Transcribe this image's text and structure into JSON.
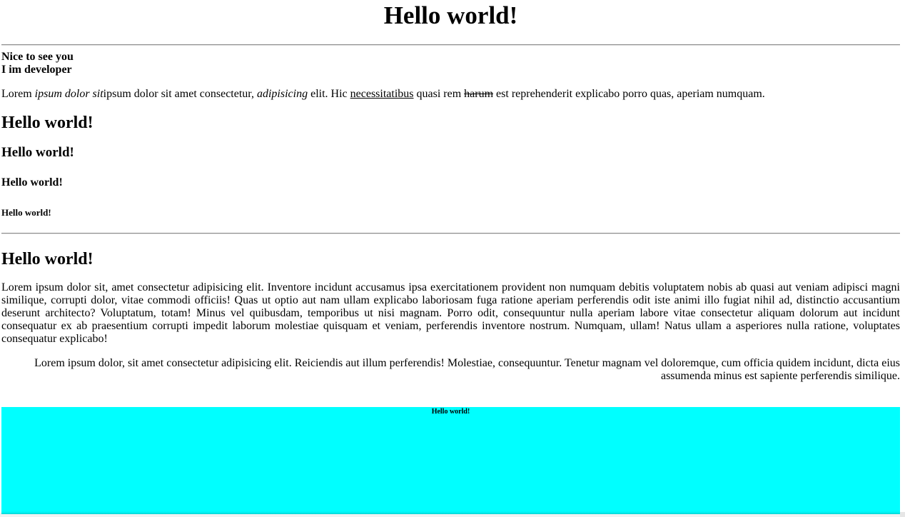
{
  "heading_main": "Hello world!",
  "intro": {
    "line1": "Nice to see you",
    "line2": "I im developer"
  },
  "paragraph1": {
    "part1": "Lorem ",
    "italic1": "ipsum dolor sit",
    "part2": "ipsum dolor sit amet consectetur, ",
    "italic2": "adipisicing",
    "part3": " elit. Hic ",
    "underlined": "necessitatibus",
    "part4": " quasi rem ",
    "struck": "harum",
    "part5": " est reprehenderit explicabo porro quas, aperiam numquam."
  },
  "headings": {
    "h2": "Hello world!",
    "h3": "Hello world!",
    "h4": "Hello world!",
    "h5": "Hello world!"
  },
  "section2": {
    "heading": "Hello world!",
    "justified_text": "Lorem ipsum dolor sit, amet consectetur adipisicing elit. Inventore incidunt accusamus ipsa exercitationem provident non numquam debitis voluptatem nobis ab quasi aut veniam adipisci magni similique, corrupti dolor, vitae commodi officiis! Quas ut optio aut nam ullam explicabo laboriosam fuga ratione aperiam perferendis odit iste animi illo fugiat nihil ad, distinctio accusantium deserunt architecto? Voluptatum, totam! Minus vel quibusdam, temporibus ut nisi magnam. Porro odit, consequuntur nulla aperiam labore vitae consectetur aliquam dolorum aut incidunt consequatur ex ab praesentium corrupti impedit laborum molestiae quisquam et veniam, perferendis inventore nostrum. Numquam, ullam! Natus ullam a asperiores nulla ratione, voluptates consequatur explicabo!",
    "right_text": "Lorem ipsum dolor, sit amet consectetur adipisicing elit. Reiciendis aut illum perferendis! Molestiae, consequuntur. Tenetur magnam vel doloremque, cum officia quidem incidunt, dicta eius assumenda minus est sapiente perferendis similique."
  },
  "cyan_box": {
    "label": "Hello world!",
    "color": "#00ffff"
  }
}
